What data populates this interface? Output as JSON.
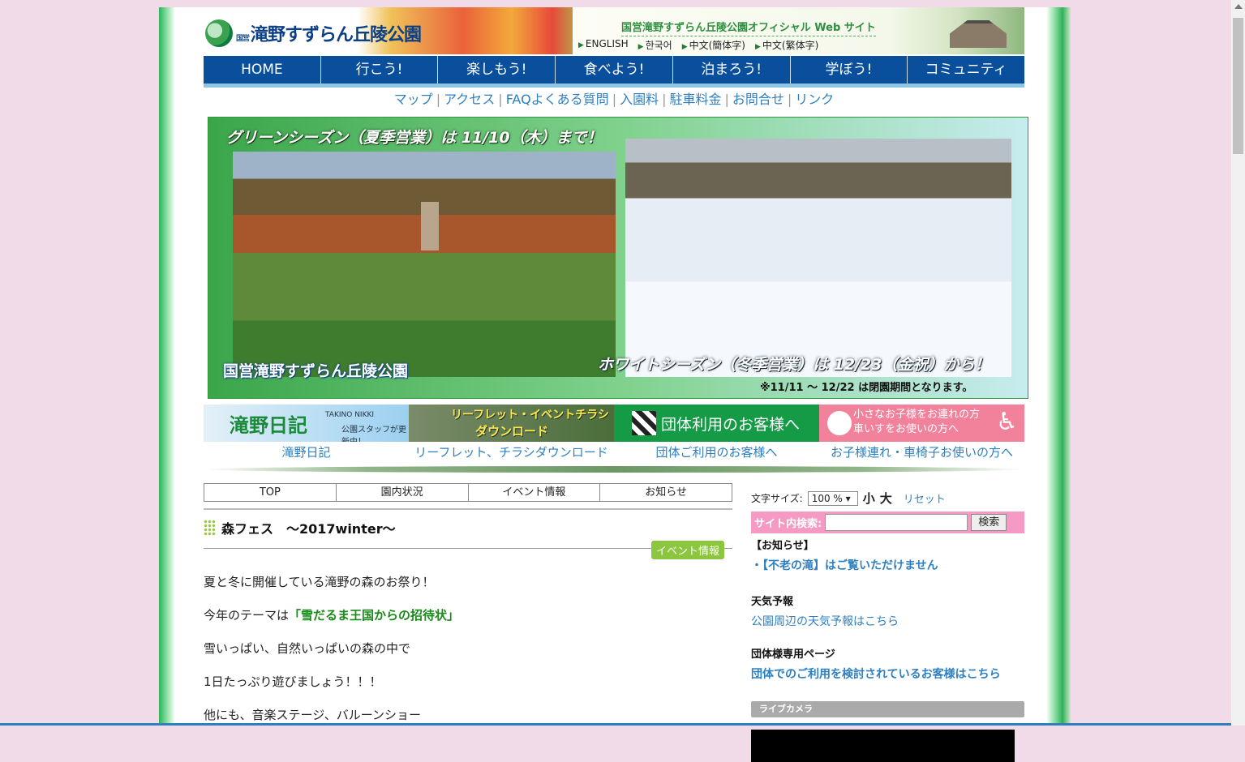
{
  "header": {
    "logo_small": "国営",
    "logo_text": "滝野すずらん丘陵公園",
    "official_site": "国営滝野すずらん丘陵公園オフィシャル Web サイト",
    "languages": [
      "ENGLISH",
      "한국어",
      "中文(簡体字)",
      "中文(繁体字)"
    ]
  },
  "nav": [
    "HOME",
    "行こう!",
    "楽しもう!",
    "食べよう!",
    "泊まろう!",
    "学ぼう!",
    "コミュニティ"
  ],
  "sublinks": [
    "マップ",
    "アクセス",
    "FAQよくある質問",
    "入園料",
    "駐車料金",
    "お問合せ",
    "リンク"
  ],
  "hero": {
    "title": "グリーンシーズン（夏季営業）は 11/10（木）まで！",
    "logo": "国営滝野すずらん丘陵公園",
    "winter": "ホワイトシーズン（冬季営業）は 12/23（金祝）から！",
    "note": "※11/11 ～ 12/22 は閉園期間となります。"
  },
  "banners": [
    {
      "title": "滝野日記",
      "sub": "TAKINO NIKKI",
      "sub2": "公園スタッフが更新中！",
      "label": "滝野日記"
    },
    {
      "title": "リーフレット・イベントチラシ",
      "title2": "ダウンロード",
      "label": "リーフレット、チラシダウンロード"
    },
    {
      "title": "団体利用のお客様へ",
      "label": "団体ご利用のお客様へ"
    },
    {
      "title": "小さなお子様をお連れの方",
      "title2": "車いすをお使いの方へ",
      "label": "お子様連れ・車椅子お使いの方へ"
    }
  ],
  "tabs": [
    "TOP",
    "園内状況",
    "イベント情報",
    "お知らせ"
  ],
  "article": {
    "title": "森フェス　～2017winter～",
    "category": "イベント情報",
    "p1": "夏と冬に開催している滝野の森のお祭り！",
    "p2_prefix": "今年のテーマは",
    "p2_highlight": "「雪だるま王国からの招待状」",
    "p3": "雪いっぱい、自然いっぱいの森の中で",
    "p4": "1日たっぷり遊びましょう！！！",
    "p5": "他にも、音楽ステージ、バルーンショー"
  },
  "sidebar": {
    "font_size_label": "文字サイズ:",
    "font_size_value": "100 %",
    "small": "小",
    "large": "大",
    "reset": "リセット",
    "search_label": "サイト内検索:",
    "search_button": "検索",
    "notice_heading": "【お知らせ】",
    "notice_item": "【不老の滝】はご覧いただけません",
    "weather_heading": "天気予報",
    "weather_link": "公園周辺の天気予報はこちら",
    "group_heading": "団体様専用ページ",
    "group_link": "団体でのご利用を検討されているお客様はこちら",
    "live_camera": "ライブカメラ"
  }
}
